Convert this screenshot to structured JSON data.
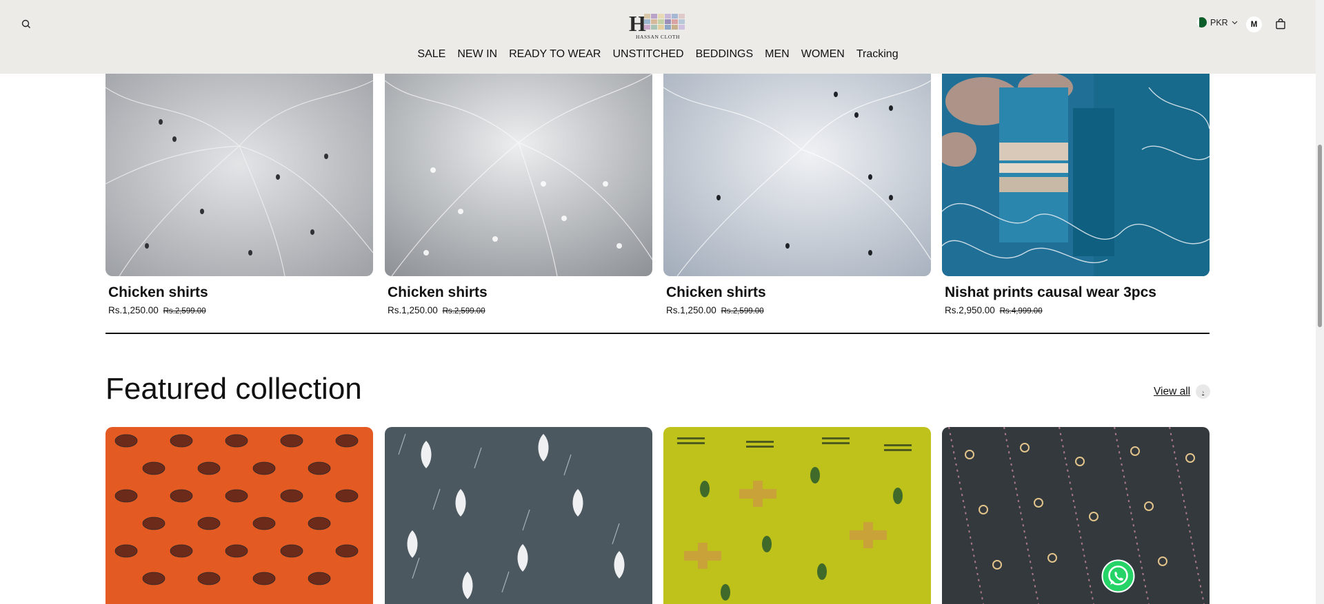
{
  "header": {
    "logo_letter": "H",
    "logo_name": "HASSAN CLOTH",
    "currency": "PKR",
    "avatar_initial": "M",
    "icons": [
      "search-icon",
      "cart-icon",
      "chevron-down-icon",
      "pakistan-flag-icon"
    ]
  },
  "nav": [
    {
      "label": "SALE"
    },
    {
      "label": "NEW IN"
    },
    {
      "label": "READY TO WEAR"
    },
    {
      "label": "UNSTITCHED"
    },
    {
      "label": "BEDDINGS"
    },
    {
      "label": "MEN"
    },
    {
      "label": "WOMEN"
    },
    {
      "label": "Tracking"
    }
  ],
  "products": [
    {
      "name": "Chicken shirts",
      "price": "Rs.1,250.00",
      "compare_price": "Rs.2,599.00"
    },
    {
      "name": "Chicken shirts",
      "price": "Rs.1,250.00",
      "compare_price": "Rs.2,599.00"
    },
    {
      "name": "Chicken shirts",
      "price": "Rs.1,250.00",
      "compare_price": "Rs.2,599.00"
    },
    {
      "name": "Nishat prints causal wear 3pcs",
      "price": "Rs.2,950.00",
      "compare_price": "Rs.4,999.00"
    }
  ],
  "featured": {
    "title": "Featured collection",
    "view_all": "View all",
    "images": [
      "orange-paisley-print",
      "grey-floral-print",
      "lime-geometric-print",
      "charcoal-floral-stripe-print"
    ]
  },
  "colors": {
    "header_bg": "#ecebe8",
    "whatsapp": "#25d366"
  }
}
